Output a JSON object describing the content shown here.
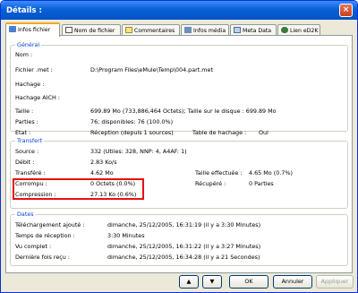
{
  "window": {
    "title": "Détails :",
    "close_glyph": "×"
  },
  "tabs": [
    "Infos fichier",
    "Nom de fichier",
    "Commentaires",
    "Infos média",
    "Meta Data",
    "Lien eD2K"
  ],
  "general": {
    "legend": "Général",
    "rows": [
      {
        "label": "Nom :",
        "value": ""
      },
      {
        "label": "Fichier .met :",
        "value": "D:\\Program Files\\eMule\\Temp\\004.part.met"
      },
      {
        "label": "Hachage :",
        "value": ""
      },
      {
        "label": "Hachage AICH :",
        "value": ""
      },
      {
        "label": "Taille :",
        "value": "699.89 Mo  (733,886,464 Octets);  Taille sur le disque :  699.89 Mo"
      },
      {
        "label": "Parties :",
        "value": "76;  disponibles: 76 (100.0%)"
      },
      {
        "label": "Etat :",
        "value": "Réception (depuis 1 sources)"
      }
    ],
    "hash_table_label": "Table de hachage :",
    "hash_table_value": "Oui"
  },
  "transfer": {
    "legend": "Transfert",
    "rows": [
      {
        "label": "Source :",
        "value": "332  (Utiles: 328, NNP: 4, A4AF: 1)"
      },
      {
        "label": "Débit :",
        "value": "2.83 Ko/s"
      },
      {
        "label": "Transféré :",
        "value": "4.62 Mo"
      },
      {
        "label": "Corrompu :",
        "value": "0 Octets (0.0%)"
      },
      {
        "label": "Compression :",
        "value": "27.13 Ko (0.6%)"
      }
    ],
    "done_label": "Taille effectuée :",
    "done_value": "4.65 Mo (0.7%)",
    "recovered_label": "Récupéré :",
    "recovered_value": "0 Parties"
  },
  "dates": {
    "legend": "Dates",
    "rows": [
      {
        "label": "Téléchargement ajouté :",
        "value": "dimanche, 25/12/2005, 16:31:19  (il y a 3:30 Minutes)"
      },
      {
        "label": "Temps de réception :",
        "value": "3:30 Minutes"
      },
      {
        "label": "Vu complet :",
        "value": "dimanche, 25/12/2005, 16:31:22  (il y a 3:27 Minutes)"
      },
      {
        "label": "Dernière fois reçu :",
        "value": "dimanche, 25/12/2005, 16:34:28  (il y a 21 Secondes)"
      }
    ]
  },
  "buttons": {
    "up": "▲",
    "down": "▼",
    "ok": "OK",
    "cancel": "Annuler",
    "apply": "Appliquer"
  }
}
